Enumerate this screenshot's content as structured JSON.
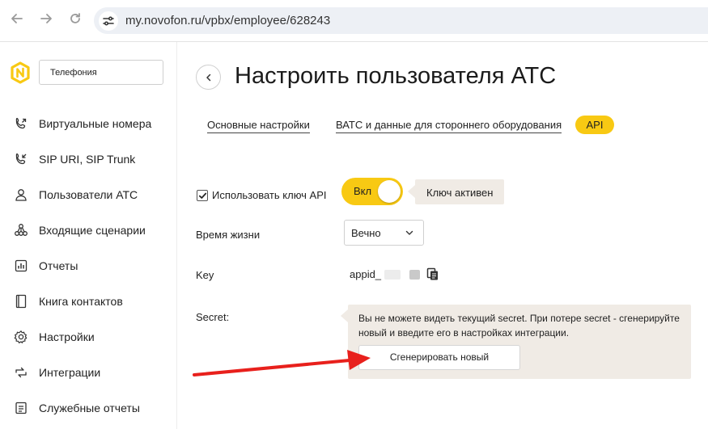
{
  "browser": {
    "url": "my.novofon.ru/vpbx/employee/628243",
    "icons": [
      "back-arrow-icon",
      "forward-arrow-icon",
      "reload-icon",
      "site-settings-icon"
    ]
  },
  "sidebar": {
    "product_select": "Телефония",
    "items": [
      {
        "label": "Виртуальные номера",
        "icon": "phone-icon"
      },
      {
        "label": "SIP URI, SIP Trunk",
        "icon": "phone-icon"
      },
      {
        "label": "Пользователи АТС",
        "icon": "user-icon"
      },
      {
        "label": "Входящие сценарии",
        "icon": "scenario-icon"
      },
      {
        "label": "Отчеты",
        "icon": "report-icon"
      },
      {
        "label": "Книга контактов",
        "icon": "contacts-book-icon"
      },
      {
        "label": "Настройки",
        "icon": "gear-icon"
      },
      {
        "label": "Интеграции",
        "icon": "integrations-icon"
      },
      {
        "label": "Служебные отчеты",
        "icon": "service-report-icon"
      }
    ]
  },
  "header": {
    "title": "Настроить пользователя АТС"
  },
  "tabs": [
    {
      "label": "Основные настройки",
      "active": false
    },
    {
      "label": "ВАТС и данные для стороннего оборудования",
      "active": false
    },
    {
      "label": "API",
      "active": true
    }
  ],
  "api": {
    "use_key_label": "Использовать ключ API",
    "use_key_checked": true,
    "toggle_label": "Вкл",
    "toggle_on": true,
    "status_hint": "Ключ активен",
    "lifetime_label": "Время жизни",
    "lifetime_value": "Вечно",
    "key_label": "Key",
    "key_value": "appid_",
    "secret_label": "Secret:",
    "secret_info": "Вы не можете видеть текущий secret. При потере secret - сгенерируйте новый и введите его в настройках интеграции.",
    "generate_button": "Сгенерировать новый"
  },
  "colors": {
    "accent": "#f8c913",
    "hint_background": "#f0ebe5",
    "annotation_arrow": "#e8201c"
  }
}
